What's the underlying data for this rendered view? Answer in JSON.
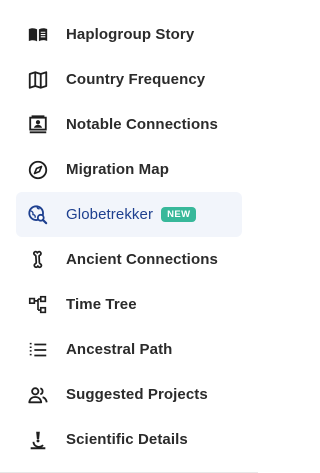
{
  "nav": {
    "items": [
      {
        "label": "Haplogroup Story",
        "icon": "book-icon"
      },
      {
        "label": "Country Frequency",
        "icon": "map-icon"
      },
      {
        "label": "Notable Connections",
        "icon": "portrait-icon"
      },
      {
        "label": "Migration Map",
        "icon": "compass-icon"
      },
      {
        "label": "Globetrekker",
        "icon": "globe-search-icon",
        "badge": "NEW",
        "active": true
      },
      {
        "label": "Ancient Connections",
        "icon": "bone-icon"
      },
      {
        "label": "Time Tree",
        "icon": "tree-icon"
      },
      {
        "label": "Ancestral Path",
        "icon": "list-icon"
      },
      {
        "label": "Suggested Projects",
        "icon": "people-icon"
      },
      {
        "label": "Scientific Details",
        "icon": "microscope-icon"
      }
    ]
  },
  "colors": {
    "text": "#2b2b2b",
    "active_text": "#1d3f8f",
    "active_bg": "#f2f5fb",
    "badge_bg": "#38b89a"
  }
}
